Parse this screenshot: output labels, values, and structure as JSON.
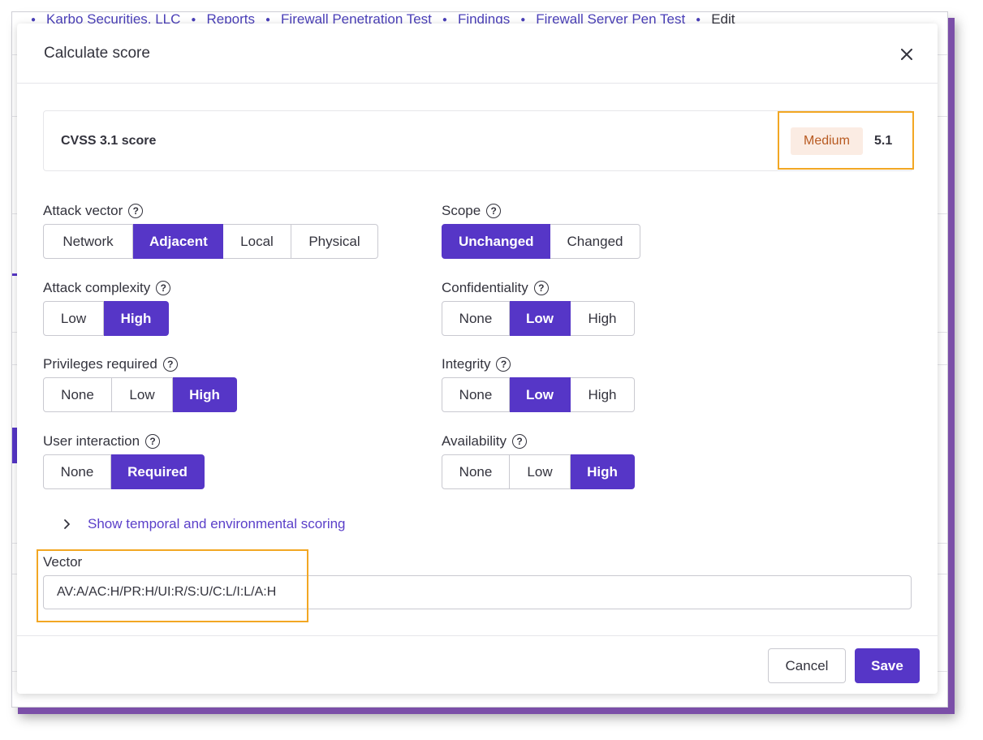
{
  "breadcrumb": [
    "Karbo Securities, LLC",
    "Reports",
    "Firewall Penetration Test",
    "Findings",
    "Firewall Server Pen Test"
  ],
  "breadcrumb_current": "Edit",
  "modal": {
    "title": "Calculate score",
    "score_label": "CVSS 3.1 score",
    "severity": "Medium",
    "score": "5.1"
  },
  "metrics": {
    "attack_vector": {
      "label": "Attack vector",
      "options": [
        "Network",
        "Adjacent",
        "Local",
        "Physical"
      ],
      "selected": "Adjacent"
    },
    "attack_complexity": {
      "label": "Attack complexity",
      "options": [
        "Low",
        "High"
      ],
      "selected": "High"
    },
    "privileges_required": {
      "label": "Privileges required",
      "options": [
        "None",
        "Low",
        "High"
      ],
      "selected": "High"
    },
    "user_interaction": {
      "label": "User interaction",
      "options": [
        "None",
        "Required"
      ],
      "selected": "Required"
    },
    "scope": {
      "label": "Scope",
      "options": [
        "Unchanged",
        "Changed"
      ],
      "selected": "Unchanged"
    },
    "confidentiality": {
      "label": "Confidentiality",
      "options": [
        "None",
        "Low",
        "High"
      ],
      "selected": "Low"
    },
    "integrity": {
      "label": "Integrity",
      "options": [
        "None",
        "Low",
        "High"
      ],
      "selected": "Low"
    },
    "availability": {
      "label": "Availability",
      "options": [
        "None",
        "Low",
        "High"
      ],
      "selected": "High"
    }
  },
  "temporal_link": "Show temporal and environmental scoring",
  "vector": {
    "label": "Vector",
    "value": "AV:A/AC:H/PR:H/UI:R/S:U/C:L/I:L/A:H"
  },
  "footer": {
    "cancel": "Cancel",
    "save": "Save"
  },
  "colors": {
    "accent": "#5636c7",
    "highlight": "#f2a723",
    "medium_badge_bg": "#fbece3",
    "medium_badge_text": "#b85a21"
  },
  "icons": {
    "close": "close-icon",
    "help": "help-icon",
    "chevron": "chevron-right-icon"
  }
}
